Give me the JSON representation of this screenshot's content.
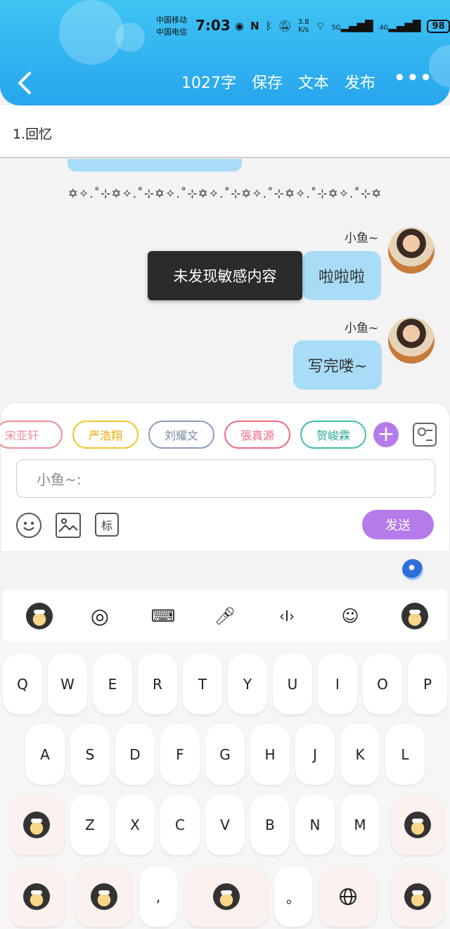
{
  "status": {
    "carrier1": "中国移动",
    "carrier2": "中国电信",
    "time": "7:03",
    "speed": "3.8",
    "speed_unit": "K/s",
    "net1": "5G",
    "net2": "4G",
    "battery": "98"
  },
  "header": {
    "word_count": "1027字",
    "save": "保存",
    "text": "文本",
    "publish": "发布",
    "more": "•••"
  },
  "title": "1.回忆",
  "chat": {
    "decoration": "✡✧.˚⊹✡✧.˚⊹✡✧.˚⊹✡✧.˚⊹✡✧.˚⊹✡✧.˚⊹✡✧.˚⊹✡",
    "messages": [
      {
        "sender": "小鱼~",
        "text": "啦啦啦"
      },
      {
        "sender": "小鱼~",
        "text": "写完喽~"
      }
    ],
    "toast": "未发现敏感内容"
  },
  "characters": [
    {
      "name": "宋亚轩",
      "color": "#f08c96"
    },
    {
      "name": "严浩翔",
      "color": "#f0c530"
    },
    {
      "name": "刘耀文",
      "color": "#8a9cba"
    },
    {
      "name": "張真源",
      "color": "#f06a80"
    },
    {
      "name": "贺峻霖",
      "color": "#3cbfad"
    }
  ],
  "input": {
    "placeholder": "小鱼~:",
    "send": "发送",
    "tag_icon_text": "标"
  },
  "keyboard": {
    "row1": [
      "Q",
      "W",
      "E",
      "R",
      "T",
      "Y",
      "U",
      "I",
      "O",
      "P"
    ],
    "row2": [
      "A",
      "S",
      "D",
      "F",
      "G",
      "H",
      "J",
      "K",
      "L"
    ],
    "row3": [
      "Z",
      "X",
      "C",
      "V",
      "B",
      "N",
      "M"
    ],
    "comma": ",",
    "period": "。"
  },
  "colors": {
    "header": "#27a5ee",
    "bubble": "#a9dcf6",
    "accent": "#b57bea"
  }
}
